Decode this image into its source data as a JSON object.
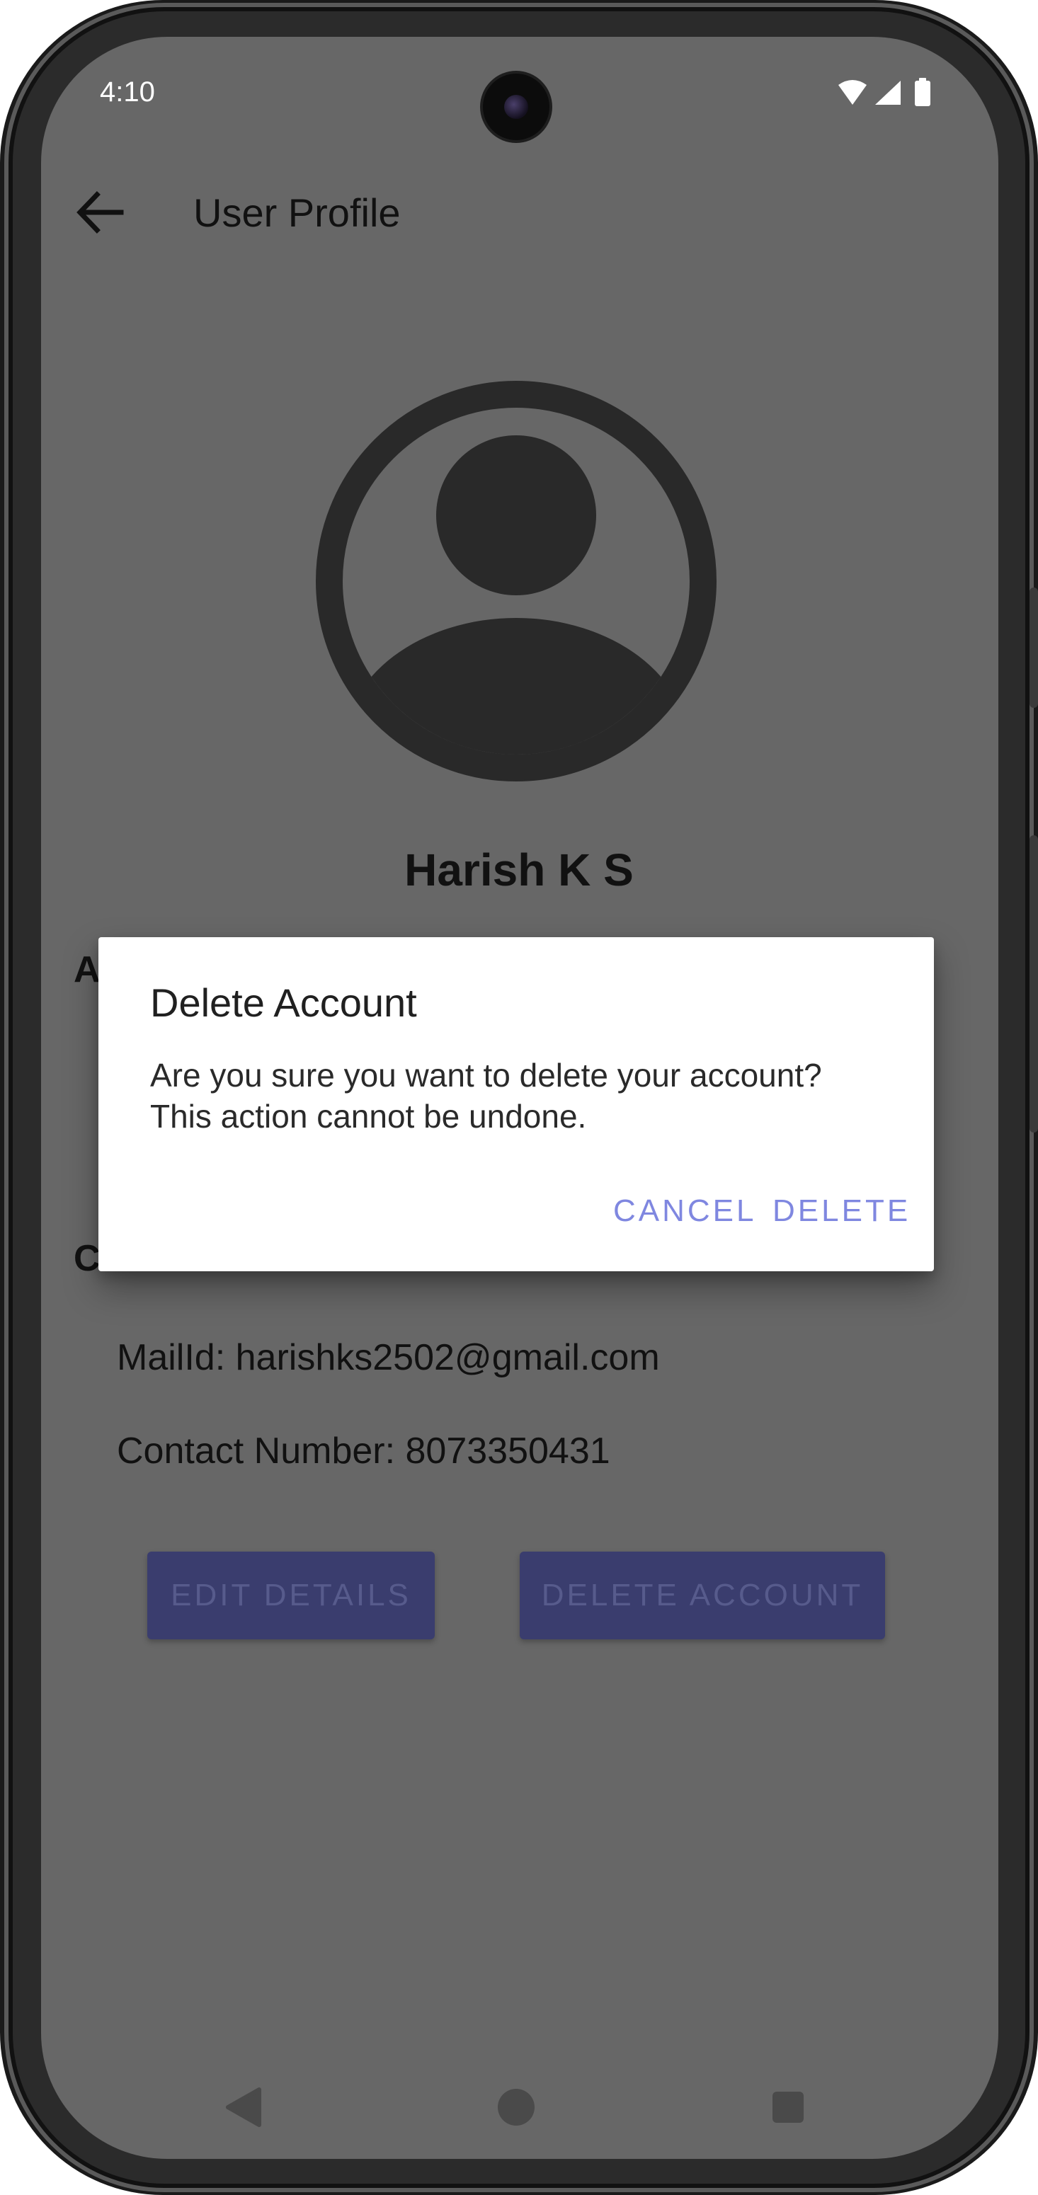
{
  "status_bar": {
    "time": "4:10",
    "icons": [
      "wifi-icon",
      "cellular-signal-icon",
      "battery-icon"
    ]
  },
  "app_bar": {
    "title": "User Profile",
    "back_icon": "arrow-back-icon"
  },
  "profile": {
    "avatar_icon": "account-circle-icon",
    "name": "Harish K S"
  },
  "sections": {
    "account_heading_partial": "A",
    "contact_heading": "Contact Details:",
    "mail_line": "MailId: harishks2502@gmail.com",
    "phone_line": "Contact Number: 8073350431"
  },
  "actions": {
    "edit_label": "EDIT DETAILS",
    "delete_label": "DELETE ACCOUNT"
  },
  "dialog": {
    "title": "Delete Account",
    "message_line1": "Are you sure you want to delete your account?",
    "message_line2": "This action cannot be undone.",
    "cancel_label": "CANCEL",
    "confirm_label": "DELETE"
  },
  "colors": {
    "scrim": "#676767",
    "button_fill": "#3a3d6e",
    "dialog_accent": "#7f87e0"
  },
  "nav_bar": {
    "icons": [
      "nav-back-icon",
      "nav-home-icon",
      "nav-recents-icon"
    ]
  }
}
